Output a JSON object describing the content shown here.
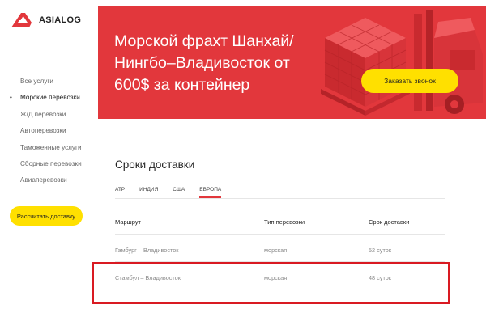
{
  "logo": {
    "text": "ASIALOG",
    "color": "#e2373c"
  },
  "sidebar": {
    "items": [
      {
        "label": "Все услуги",
        "active": false
      },
      {
        "label": "Морские перевозки",
        "active": true,
        "marker": "•"
      },
      {
        "label": "Ж/Д перевозки",
        "active": false
      },
      {
        "label": "Автоперевозки",
        "active": false
      },
      {
        "label": "Таможенные услуги",
        "active": false
      },
      {
        "label": "Сборные перевозки",
        "active": false
      },
      {
        "label": "Авиаперевозки",
        "active": false
      }
    ],
    "calc_button": "Рассчитать доставку"
  },
  "banner": {
    "title": "Морской фрахт Шанхай/ Нингбо–Владивосток от 600$ за контейнер",
    "call_button": "Заказать звонок",
    "bg_color": "#e2373c",
    "button_color": "#ffe000"
  },
  "delivery": {
    "title": "Сроки доставки",
    "tabs": [
      {
        "label": "АТР",
        "active": false
      },
      {
        "label": "ИНДИЯ",
        "active": false
      },
      {
        "label": "США",
        "active": false
      },
      {
        "label": "ЕВРОПА",
        "active": true
      }
    ],
    "columns": [
      "Маршрут",
      "Тип перевозки",
      "Срок доставки"
    ],
    "rows": [
      {
        "route": "Гамбург – Владивосток",
        "type": "морская",
        "term": "52 суток"
      },
      {
        "route": "Стамбул – Владивосток",
        "type": "морская",
        "term": "48 суток"
      }
    ]
  }
}
